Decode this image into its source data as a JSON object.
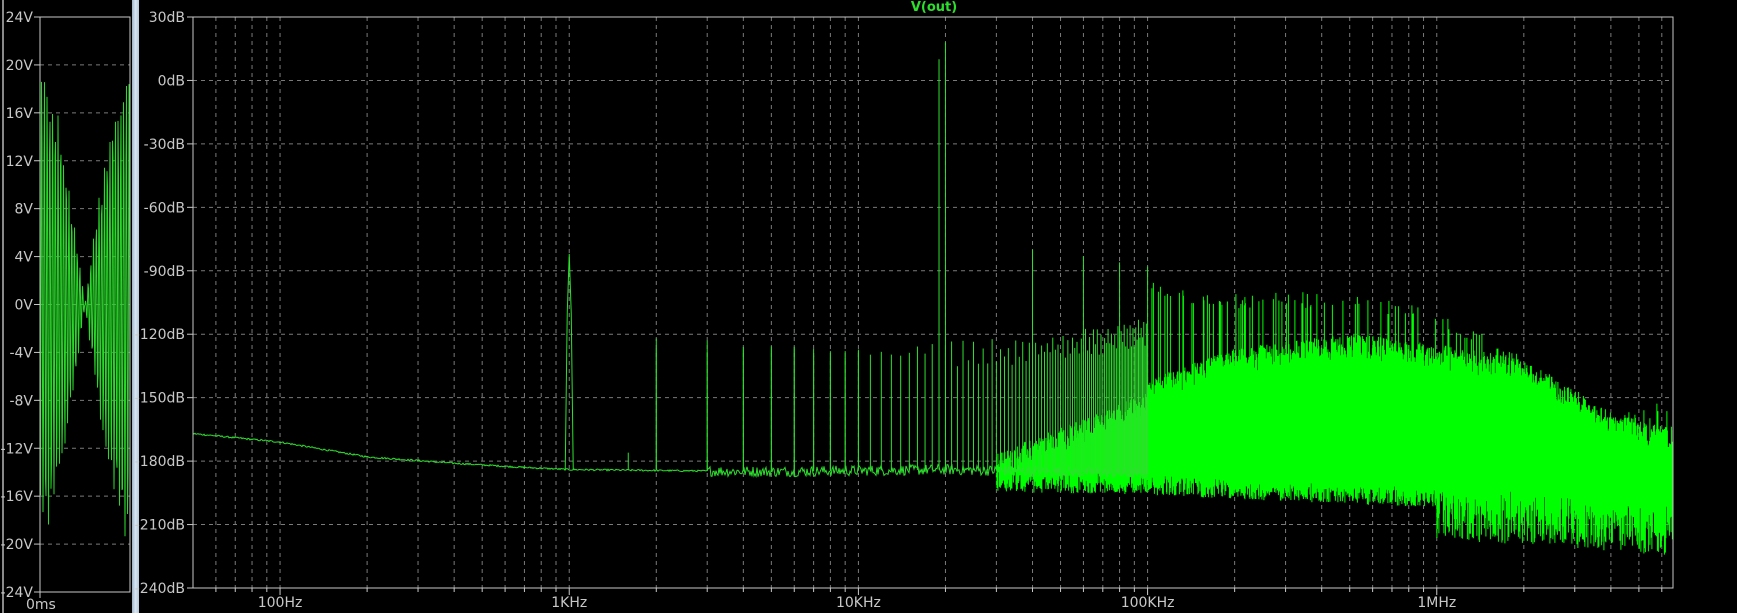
{
  "chart_data": [
    {
      "type": "line",
      "pane": "transient",
      "title": "",
      "xlabel": "",
      "ylabel": "",
      "ylim": [
        -24,
        24
      ],
      "yticks": [
        "24V",
        "20V",
        "16V",
        "12V",
        "8V",
        "4V",
        "0V",
        "-4V",
        "-8V",
        "-12V",
        "-16V",
        "-20V",
        "-24V"
      ],
      "ytick_values": [
        24,
        20,
        16,
        12,
        8,
        4,
        0,
        -4,
        -8,
        -12,
        -16,
        -20,
        -24
      ],
      "xticks": [
        "0ms"
      ],
      "series": [
        {
          "name": "V(out)",
          "color": "#2bd82b",
          "peak_amplitude_V": 20,
          "description_shape": "amplitude-modulated oscillation, envelope 20V to ~0V and back to 20V"
        }
      ],
      "grid": true
    },
    {
      "type": "line",
      "pane": "fft",
      "title": "V(out)",
      "xlabel": "",
      "ylabel": "",
      "xscale": "log",
      "xlim": [
        50,
        6560000
      ],
      "ylim": [
        -240,
        30
      ],
      "yticks": [
        "30dB",
        "0dB",
        "-30dB",
        "-60dB",
        "-90dB",
        "-120dB",
        "-150dB",
        "-180dB",
        "-210dB",
        "-240dB"
      ],
      "ytick_values": [
        30,
        0,
        -30,
        -60,
        -90,
        -120,
        -150,
        -180,
        -210,
        -240
      ],
      "xticks": [
        "100Hz",
        "1KHz",
        "10KHz",
        "100KHz",
        "1MHz"
      ],
      "xtick_values": [
        100,
        1000,
        10000,
        100000,
        1000000
      ],
      "series": [
        {
          "name": "V(out)",
          "color": "#00ff00",
          "noise_floor": [
            [
              50,
              -167
            ],
            [
              100,
              -171
            ],
            [
              200,
              -178
            ],
            [
              400,
              -181
            ],
            [
              700,
              -183
            ],
            [
              1000,
              -184
            ],
            [
              5000,
              -185
            ],
            [
              20000,
              -184
            ],
            [
              100000,
              -186
            ],
            [
              300000,
              -189
            ],
            [
              1000000,
              -192
            ],
            [
              3000000,
              -196
            ],
            [
              6500000,
              -200
            ]
          ],
          "peaks": [
            [
              1000,
              -82
            ],
            [
              1600,
              -176
            ],
            [
              2000,
              -122
            ],
            [
              3000,
              -123
            ],
            [
              4000,
              -126
            ],
            [
              5000,
              -127
            ],
            [
              6000,
              -127
            ],
            [
              7000,
              -127
            ],
            [
              8000,
              -128
            ],
            [
              9000,
              -128
            ],
            [
              10000,
              -128
            ],
            [
              19000,
              10
            ],
            [
              20000,
              18
            ],
            [
              40000,
              -80
            ],
            [
              60000,
              -83
            ],
            [
              80000,
              -86
            ],
            [
              100000,
              -88
            ]
          ],
          "broadband_envelope_top": [
            [
              100000,
              -95
            ],
            [
              200000,
              -100
            ],
            [
              400000,
              -100
            ],
            [
              800000,
              -105
            ],
            [
              1500000,
              -120
            ],
            [
              3000000,
              -148
            ],
            [
              4000000,
              -157
            ],
            [
              6500000,
              -150
            ]
          ],
          "broadband_fill_top": [
            [
              100000,
              -150
            ],
            [
              200000,
              -135
            ],
            [
              500000,
              -128
            ],
            [
              1000000,
              -133
            ],
            [
              2000000,
              -140
            ],
            [
              4000000,
              -165
            ],
            [
              6500000,
              -172
            ]
          ]
        }
      ],
      "grid": true
    }
  ]
}
